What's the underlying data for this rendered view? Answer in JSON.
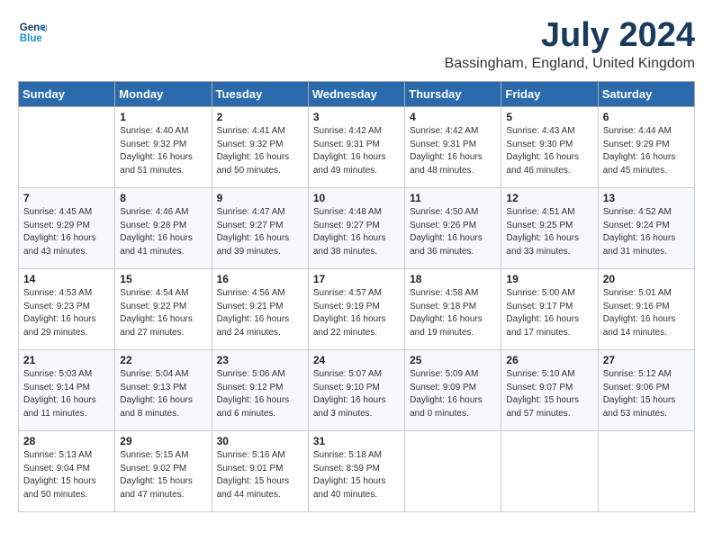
{
  "header": {
    "logo_line1": "General",
    "logo_line2": "Blue",
    "month_title": "July 2024",
    "location": "Bassingham, England, United Kingdom"
  },
  "weekdays": [
    "Sunday",
    "Monday",
    "Tuesday",
    "Wednesday",
    "Thursday",
    "Friday",
    "Saturday"
  ],
  "weeks": [
    [
      {
        "day": "",
        "info": ""
      },
      {
        "day": "1",
        "info": "Sunrise: 4:40 AM\nSunset: 9:32 PM\nDaylight: 16 hours\nand 51 minutes."
      },
      {
        "day": "2",
        "info": "Sunrise: 4:41 AM\nSunset: 9:32 PM\nDaylight: 16 hours\nand 50 minutes."
      },
      {
        "day": "3",
        "info": "Sunrise: 4:42 AM\nSunset: 9:31 PM\nDaylight: 16 hours\nand 49 minutes."
      },
      {
        "day": "4",
        "info": "Sunrise: 4:42 AM\nSunset: 9:31 PM\nDaylight: 16 hours\nand 48 minutes."
      },
      {
        "day": "5",
        "info": "Sunrise: 4:43 AM\nSunset: 9:30 PM\nDaylight: 16 hours\nand 46 minutes."
      },
      {
        "day": "6",
        "info": "Sunrise: 4:44 AM\nSunset: 9:29 PM\nDaylight: 16 hours\nand 45 minutes."
      }
    ],
    [
      {
        "day": "7",
        "info": "Sunrise: 4:45 AM\nSunset: 9:29 PM\nDaylight: 16 hours\nand 43 minutes."
      },
      {
        "day": "8",
        "info": "Sunrise: 4:46 AM\nSunset: 9:28 PM\nDaylight: 16 hours\nand 41 minutes."
      },
      {
        "day": "9",
        "info": "Sunrise: 4:47 AM\nSunset: 9:27 PM\nDaylight: 16 hours\nand 39 minutes."
      },
      {
        "day": "10",
        "info": "Sunrise: 4:48 AM\nSunset: 9:27 PM\nDaylight: 16 hours\nand 38 minutes."
      },
      {
        "day": "11",
        "info": "Sunrise: 4:50 AM\nSunset: 9:26 PM\nDaylight: 16 hours\nand 36 minutes."
      },
      {
        "day": "12",
        "info": "Sunrise: 4:51 AM\nSunset: 9:25 PM\nDaylight: 16 hours\nand 33 minutes."
      },
      {
        "day": "13",
        "info": "Sunrise: 4:52 AM\nSunset: 9:24 PM\nDaylight: 16 hours\nand 31 minutes."
      }
    ],
    [
      {
        "day": "14",
        "info": "Sunrise: 4:53 AM\nSunset: 9:23 PM\nDaylight: 16 hours\nand 29 minutes."
      },
      {
        "day": "15",
        "info": "Sunrise: 4:54 AM\nSunset: 9:22 PM\nDaylight: 16 hours\nand 27 minutes."
      },
      {
        "day": "16",
        "info": "Sunrise: 4:56 AM\nSunset: 9:21 PM\nDaylight: 16 hours\nand 24 minutes."
      },
      {
        "day": "17",
        "info": "Sunrise: 4:57 AM\nSunset: 9:19 PM\nDaylight: 16 hours\nand 22 minutes."
      },
      {
        "day": "18",
        "info": "Sunrise: 4:58 AM\nSunset: 9:18 PM\nDaylight: 16 hours\nand 19 minutes."
      },
      {
        "day": "19",
        "info": "Sunrise: 5:00 AM\nSunset: 9:17 PM\nDaylight: 16 hours\nand 17 minutes."
      },
      {
        "day": "20",
        "info": "Sunrise: 5:01 AM\nSunset: 9:16 PM\nDaylight: 16 hours\nand 14 minutes."
      }
    ],
    [
      {
        "day": "21",
        "info": "Sunrise: 5:03 AM\nSunset: 9:14 PM\nDaylight: 16 hours\nand 11 minutes."
      },
      {
        "day": "22",
        "info": "Sunrise: 5:04 AM\nSunset: 9:13 PM\nDaylight: 16 hours\nand 8 minutes."
      },
      {
        "day": "23",
        "info": "Sunrise: 5:06 AM\nSunset: 9:12 PM\nDaylight: 16 hours\nand 6 minutes."
      },
      {
        "day": "24",
        "info": "Sunrise: 5:07 AM\nSunset: 9:10 PM\nDaylight: 16 hours\nand 3 minutes."
      },
      {
        "day": "25",
        "info": "Sunrise: 5:09 AM\nSunset: 9:09 PM\nDaylight: 16 hours\nand 0 minutes."
      },
      {
        "day": "26",
        "info": "Sunrise: 5:10 AM\nSunset: 9:07 PM\nDaylight: 15 hours\nand 57 minutes."
      },
      {
        "day": "27",
        "info": "Sunrise: 5:12 AM\nSunset: 9:06 PM\nDaylight: 15 hours\nand 53 minutes."
      }
    ],
    [
      {
        "day": "28",
        "info": "Sunrise: 5:13 AM\nSunset: 9:04 PM\nDaylight: 15 hours\nand 50 minutes."
      },
      {
        "day": "29",
        "info": "Sunrise: 5:15 AM\nSunset: 9:02 PM\nDaylight: 15 hours\nand 47 minutes."
      },
      {
        "day": "30",
        "info": "Sunrise: 5:16 AM\nSunset: 9:01 PM\nDaylight: 15 hours\nand 44 minutes."
      },
      {
        "day": "31",
        "info": "Sunrise: 5:18 AM\nSunset: 8:59 PM\nDaylight: 15 hours\nand 40 minutes."
      },
      {
        "day": "",
        "info": ""
      },
      {
        "day": "",
        "info": ""
      },
      {
        "day": "",
        "info": ""
      }
    ]
  ]
}
